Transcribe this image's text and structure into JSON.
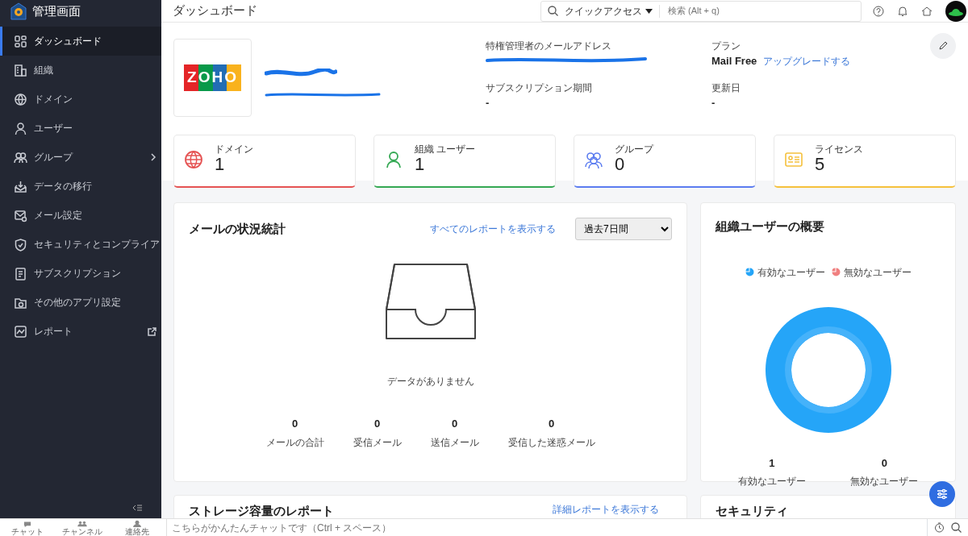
{
  "app_title": "管理画面",
  "sidebar": {
    "items": [
      {
        "label": "ダッシュボード",
        "selected": true
      },
      {
        "label": "組織",
        "selected": false
      },
      {
        "label": "ドメイン",
        "selected": false
      },
      {
        "label": "ユーザー",
        "selected": false
      },
      {
        "label": "グループ",
        "selected": false,
        "kind": "submenu"
      },
      {
        "label": "データの移行",
        "selected": false
      },
      {
        "label": "メール設定",
        "selected": false
      },
      {
        "label": "セキュリティとコンプライア",
        "selected": false
      },
      {
        "label": "サブスクリプション",
        "selected": false
      },
      {
        "label": "その他のアプリ設定",
        "selected": false
      },
      {
        "label": "レポート",
        "selected": false,
        "kind": "external"
      }
    ]
  },
  "header": {
    "title": "ダッシュボード",
    "quick_access": "クイックアクセス",
    "search": {
      "placeholder": "検索 (Alt + q)"
    }
  },
  "profile": {
    "logo_text": "ZOHO",
    "fields": [
      {
        "label": "特権管理者のメールアドレス",
        "redacted": true
      },
      {
        "label": "プラン",
        "value": "Mail Free",
        "link": "アップグレードする"
      },
      {
        "label": "サブスクリプション期間",
        "value": "-"
      },
      {
        "label": "更新日",
        "value": "-"
      }
    ]
  },
  "stat_cards": [
    {
      "label": "ドメイン",
      "value": "1",
      "color": "#e55353"
    },
    {
      "label": "組織 ユーザー",
      "value": "1",
      "color": "#34a853"
    },
    {
      "label": "グループ",
      "value": "0",
      "color": "#5b7cf0"
    },
    {
      "label": "ライセンス",
      "value": "5",
      "color": "#f5c13c"
    }
  ],
  "mail_stats": {
    "title": "メールの状況統計",
    "link": "すべてのレポートを表示する",
    "period": "過去7日間",
    "empty_text": "データがありません",
    "totals": [
      {
        "value": "0",
        "label": "メールの合計"
      },
      {
        "value": "0",
        "label": "受信メール"
      },
      {
        "value": "0",
        "label": "送信メール"
      },
      {
        "value": "0",
        "label": "受信した迷惑メール"
      }
    ]
  },
  "user_overview": {
    "title": "組織ユーザーの概要",
    "legend": [
      {
        "label": "有効なユーザー",
        "color": "#25a5f8"
      },
      {
        "label": "無効なユーザー",
        "color": "#f08080"
      }
    ],
    "totals": [
      {
        "value": "1",
        "label": "有効なユーザー"
      },
      {
        "value": "0",
        "label": "無効なユーザー"
      }
    ]
  },
  "lower_cards": [
    {
      "title": "ストレージ容量のレポート",
      "link": "詳細レポートを表示する"
    },
    {
      "title": "セキュリティ"
    }
  ],
  "chat_bar": {
    "tabs": [
      "チャット",
      "チャンネル",
      "連絡先"
    ],
    "placeholder": "こちらがかんたんチャットです（Ctrl + スペース）"
  }
}
